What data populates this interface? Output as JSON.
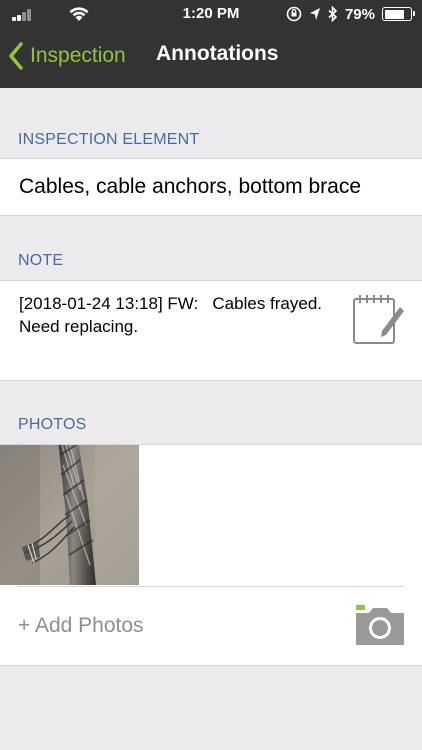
{
  "status_bar": {
    "time": "1:20 PM",
    "battery_percent_label": "79%",
    "battery_level": 0.79,
    "icons": [
      "signal-icon",
      "wifi-icon",
      "screen-rotation-lock-icon",
      "location-icon",
      "bluetooth-icon",
      "battery-icon"
    ]
  },
  "nav": {
    "back_label": "Inspection",
    "title": "Annotations",
    "accent_color": "#8dc63f"
  },
  "sections": {
    "element_header": "INSPECTION ELEMENT",
    "element_value": "Cables, cable anchors, bottom brace",
    "note_header": "NOTE",
    "note_text": "[2018-01-24 13:18] FW:   Cables frayed. Need replacing.",
    "photos_header": "PHOTOS",
    "add_photos_label": "+ Add  Photos"
  },
  "colors": {
    "header_text": "#4a6a9b",
    "nav_background": "#333333",
    "page_background": "#ebebee"
  }
}
